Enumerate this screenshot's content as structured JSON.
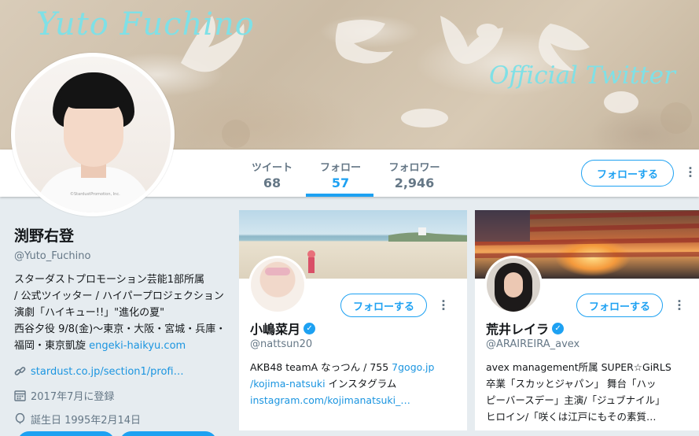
{
  "banner": {
    "title": "Yuto Fuchino",
    "subtitle": "Official Twitter"
  },
  "nav": {
    "stats": [
      {
        "label": "ツイート",
        "value": "68"
      },
      {
        "label": "フォロー",
        "value": "57"
      },
      {
        "label": "フォロワー",
        "value": "2,946"
      }
    ],
    "follow_label": "フォローする",
    "more_label": "⋮"
  },
  "profile": {
    "name": "渕野右登",
    "handle": "@Yuto_Fuchino",
    "bio_lines": [
      "スターダストプロモーション芸能1部所属",
      "/ 公式ツイッター / ハイパープロジェクション演劇「ハイキュー!!」\"進化の夏\"",
      "西谷夕役 9/8(金)〜東京・大阪・宮城・兵庫・福岡・東京凱旋"
    ],
    "bio_link": "engeki-haikyu.com",
    "website": "stardust.co.jp/section1/profi…",
    "joined": "2017年7月に登録",
    "birthday": "誕生日 1995年2月14日",
    "avatar_watermark": "©StardustPromotion, Inc."
  },
  "cards": [
    {
      "name": "小嶋菜月",
      "handle": "@nattsun20",
      "follow_label": "フォローする",
      "bio_text": "AKB48 teamA なっつん / 755 ",
      "bio_link1": "7gogo.jp",
      "bio_link2": "/kojima-natsuki",
      "bio_text2": " インスタグラム",
      "bio_link3": "instagram.com/kojimanatsuki_…"
    },
    {
      "name": "荒井レイラ",
      "handle": "@ARAIREIRA_avex",
      "follow_label": "フォローする",
      "bio_lines": [
        "avex management所属 SUPER☆GiRLS",
        "卒業「スカッとジャパン」 舞台「ハッ",
        "ピーバースデー」主演/「ジュブナイル」",
        "ヒロイン/「咲くは江戸にもその素質…"
      ]
    }
  ],
  "colors": {
    "accent": "#1da1f2",
    "link": "#1b95e0",
    "muted": "#657786",
    "background": "#e6ecf0",
    "banner_text": "#7fe0e6"
  }
}
